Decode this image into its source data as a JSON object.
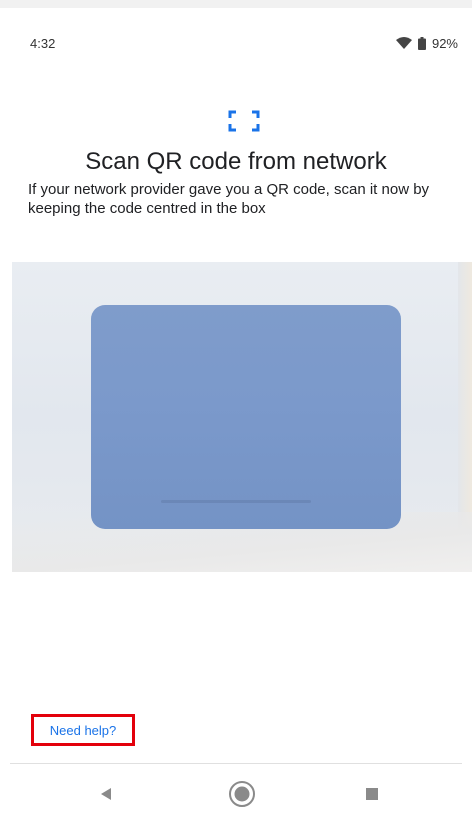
{
  "status_bar": {
    "time": "4:32",
    "battery": "92%",
    "icons": [
      "wifi-icon",
      "battery-icon"
    ]
  },
  "header": {
    "icon": "qr-scan-icon",
    "title": "Scan QR code from network",
    "description": "If your network provider gave you a QR code, scan it now by keeping the code centred in the box"
  },
  "camera": {
    "scan_box_color": "#7b99cb"
  },
  "footer": {
    "help_link": "Need help?"
  },
  "navigation": {
    "buttons": [
      "back-icon",
      "home-icon",
      "recents-icon"
    ]
  },
  "colors": {
    "link": "#1a73e8",
    "highlight_border": "#e3000b"
  }
}
